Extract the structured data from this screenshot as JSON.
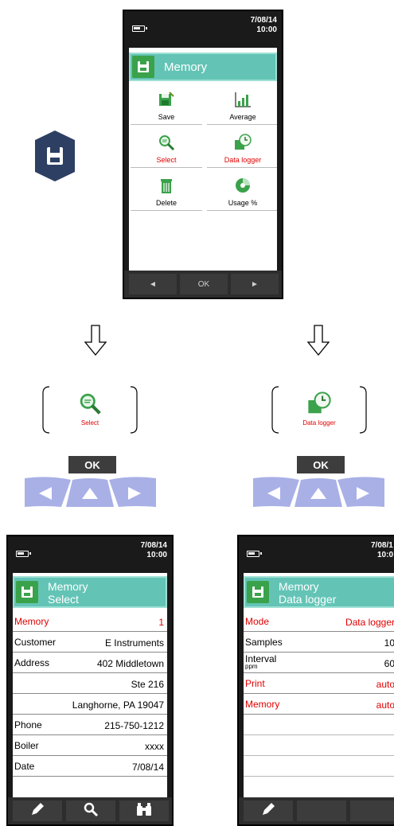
{
  "top_device": {
    "clock": {
      "date": "7/08/14",
      "time": "10:00"
    },
    "header_title": "Memory",
    "menu": [
      {
        "label": "Save",
        "icon": "save-icon",
        "highlight": false
      },
      {
        "label": "Average",
        "icon": "average-chart-icon",
        "highlight": false
      },
      {
        "label": "Select",
        "icon": "select-magnifier-icon",
        "highlight": true
      },
      {
        "label": "Data logger",
        "icon": "data-logger-clock-icon",
        "highlight": true
      },
      {
        "label": "Delete",
        "icon": "trash-icon",
        "highlight": false
      },
      {
        "label": "Usage %",
        "icon": "usage-pie-icon",
        "highlight": false
      }
    ],
    "nav": {
      "left": "◄",
      "ok": "OK",
      "right": "►"
    }
  },
  "left_branch": {
    "zoom_label": "Select",
    "ok_label": "OK"
  },
  "right_branch": {
    "zoom_label": "Data logger",
    "ok_label": "OK"
  },
  "select_device": {
    "clock": {
      "date": "7/08/14",
      "time": "10:00"
    },
    "header_line1": "Memory",
    "header_line2": "Select",
    "rows": [
      {
        "label": "Memory",
        "value": "1",
        "highlight": true
      },
      {
        "label": "Customer",
        "value": "E Instruments",
        "highlight": false
      },
      {
        "label": "Address",
        "value": "402 Middletown",
        "highlight": false
      },
      {
        "label": "",
        "value": "Ste 216",
        "highlight": false
      },
      {
        "label": "",
        "value": "Langhorne, PA 19047",
        "highlight": false
      },
      {
        "label": "Phone",
        "value": "215-750-1212",
        "highlight": false
      },
      {
        "label": "Boiler",
        "value": "xxxx",
        "highlight": false
      },
      {
        "label": "Date",
        "value": "7/08/14",
        "highlight": false
      }
    ]
  },
  "datalogger_device": {
    "clock": {
      "date": "7/08/1",
      "time": "10:0"
    },
    "header_line1": "Memory",
    "header_line2": "Data logger",
    "rows": [
      {
        "label": "Mode",
        "value": "Data logger",
        "highlight": true
      },
      {
        "label": "Samples",
        "value": "10",
        "highlight": false
      },
      {
        "label": "Interval",
        "sublabel": "ppm",
        "value": "60",
        "highlight": false
      },
      {
        "label": "Print",
        "value": "auto",
        "highlight": true
      },
      {
        "label": "Memory",
        "value": "auto",
        "highlight": true
      }
    ]
  },
  "colors": {
    "header_teal": "#63c4b6",
    "icon_green": "#3aa24a",
    "highlight_red": "#e00000",
    "badge_navy": "#2d3f63",
    "keypad_blue": "#a9b0e6"
  }
}
